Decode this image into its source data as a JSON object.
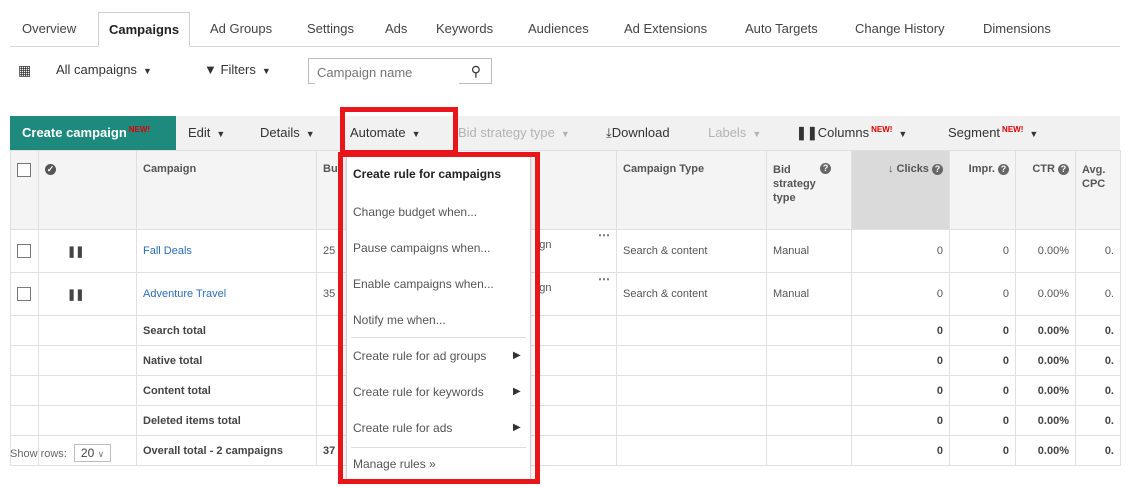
{
  "tabs": [
    "Overview",
    "Campaigns",
    "Ad Groups",
    "Settings",
    "Ads",
    "Keywords",
    "Audiences",
    "Ad Extensions",
    "Auto Targets",
    "Change History",
    "Dimensions"
  ],
  "filters": {
    "scope": "All campaigns",
    "filters_label": "Filters",
    "search_placeholder": "Campaign name"
  },
  "toolbar": {
    "create": "Create campaign",
    "new_badge": "NEW!",
    "edit": "Edit",
    "details": "Details",
    "automate": "Automate",
    "bid_strategy_type": "Bid strategy type",
    "download": "Download",
    "labels": "Labels",
    "columns": "Columns",
    "segment": "Segment"
  },
  "table": {
    "headers": {
      "campaign": "Campaign",
      "budget": "Bu",
      "campaign_type": "Campaign Type",
      "bid_strategy": "Bid strategy type",
      "clicks": "Clicks",
      "impr": "Impr.",
      "ctr": "CTR",
      "avg_cpc": "Avg. CPC"
    },
    "rows": [
      {
        "name": "Fall Deals",
        "budget": "25",
        "mid": "gn",
        "type": "Search & content",
        "bid": "Manual",
        "clicks": "0",
        "impr": "0",
        "ctr": "0.00%",
        "cpc": "0."
      },
      {
        "name": "Adventure Travel",
        "budget": "35",
        "mid": "gn",
        "type": "Search & content",
        "bid": "Manual",
        "clicks": "0",
        "impr": "0",
        "ctr": "0.00%",
        "cpc": "0."
      }
    ],
    "totals": [
      {
        "label": "Search total",
        "budget": "",
        "clicks": "0",
        "impr": "0",
        "ctr": "0.00%",
        "cpc": "0."
      },
      {
        "label": "Native total",
        "budget": "",
        "clicks": "0",
        "impr": "0",
        "ctr": "0.00%",
        "cpc": "0."
      },
      {
        "label": "Content total",
        "budget": "",
        "clicks": "0",
        "impr": "0",
        "ctr": "0.00%",
        "cpc": "0."
      },
      {
        "label": "Deleted items total",
        "budget": "",
        "clicks": "0",
        "impr": "0",
        "ctr": "0.00%",
        "cpc": "0."
      },
      {
        "label": "Overall total - 2 campaigns",
        "budget": "37",
        "clicks": "0",
        "impr": "0",
        "ctr": "0.00%",
        "cpc": "0."
      }
    ]
  },
  "automate_menu": {
    "header": "Create rule for campaigns",
    "items": [
      "Change budget when...",
      "Pause campaigns when...",
      "Enable campaigns when...",
      "Notify me when...",
      "Create rule for ad groups",
      "Create rule for keywords",
      "Create rule for ads",
      "Manage rules »"
    ]
  },
  "footer": {
    "show_rows_label": "Show rows:",
    "show_rows_value": "20"
  },
  "colors": {
    "create_button": "#1e8a7e",
    "highlight": "#e8151b",
    "link": "#2a6ebb",
    "new_badge": "#e00000"
  }
}
